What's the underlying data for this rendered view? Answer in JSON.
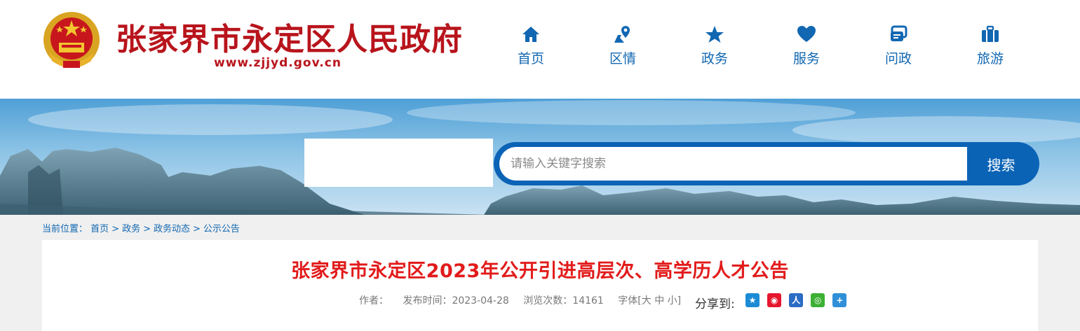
{
  "header": {
    "site_title": "张家界市永定区人民政府",
    "site_url": "www.zjjyd.gov.cn"
  },
  "nav": [
    {
      "label": "首页",
      "icon": "home-icon"
    },
    {
      "label": "区情",
      "icon": "location-icon"
    },
    {
      "label": "政务",
      "icon": "star-icon"
    },
    {
      "label": "服务",
      "icon": "heart-icon"
    },
    {
      "label": "问政",
      "icon": "chat-icon"
    },
    {
      "label": "旅游",
      "icon": "suitcase-icon"
    }
  ],
  "search": {
    "placeholder": "请输入关键字搜索",
    "button_label": "搜索"
  },
  "breadcrumb": {
    "prefix": "当前位置：",
    "items": [
      "首页",
      "政务",
      "政务动态",
      "公示公告"
    ],
    "separator": ">"
  },
  "article": {
    "title": "张家界市永定区2023年公开引进高层次、高学历人才公告",
    "author_label": "作者：",
    "published": "发布时间：2023-04-28",
    "views": "浏览次数：14161",
    "font_size": "字体[大 中 小]",
    "share_label": "分享到:"
  },
  "colors": {
    "brand_red": "#b8141c",
    "nav_blue": "#1167b1",
    "search_blue": "#0b63b6",
    "title_red": "#e21b1b"
  }
}
